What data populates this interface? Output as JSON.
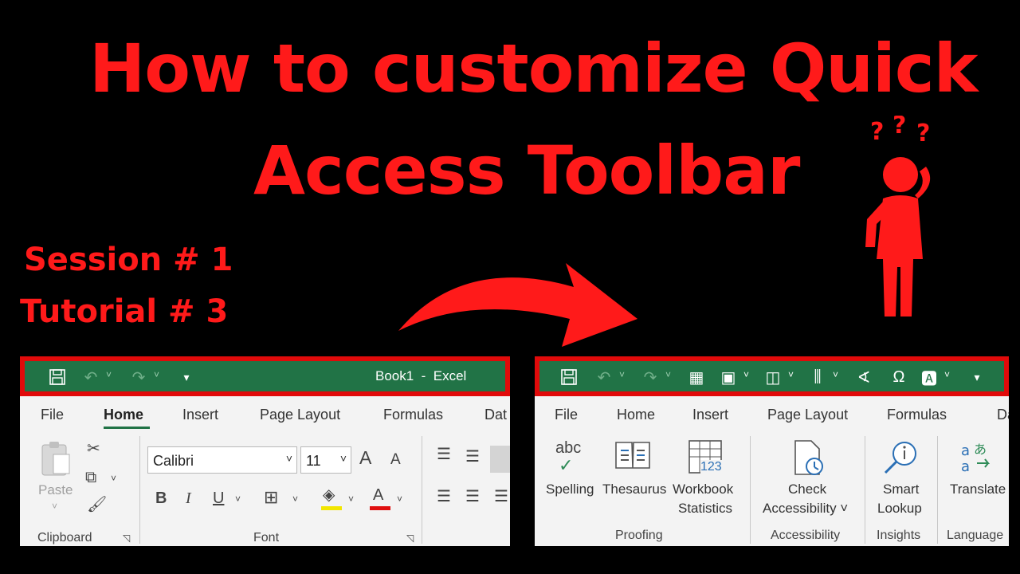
{
  "headline": {
    "line1": "How to customize Quick",
    "line2": "Access Toolbar"
  },
  "session": {
    "line1": "Session # 1",
    "line2": "Tutorial # 3"
  },
  "colors": {
    "accent_red": "#ff1a1a",
    "excel_green": "#217346",
    "highlight_border": "#e10a0a"
  },
  "left_panel": {
    "window_title": "Book1  -  Excel",
    "qat_icons": [
      "save-icon",
      "undo-icon",
      "redo-icon",
      "customize-qat-icon"
    ],
    "tabs": [
      "File",
      "Home",
      "Insert",
      "Page Layout",
      "Formulas",
      "Dat"
    ],
    "active_tab": "Home",
    "clipboard": {
      "paste_label": "Paste",
      "group_label": "Clipboard"
    },
    "font": {
      "font_name": "Calibri",
      "font_size": "11",
      "bold": "B",
      "italic": "I",
      "underline": "U",
      "grow": "A",
      "shrink": "A",
      "font_color": "A",
      "group_label": "Font"
    }
  },
  "right_panel": {
    "qat_icons": [
      "save-icon",
      "undo-icon",
      "redo-icon",
      "form-icon",
      "picture-icon",
      "shapes-icon",
      "chart-icon",
      "ink-icon",
      "symbol-icon",
      "text-box-icon",
      "customize-qat-icon"
    ],
    "tabs": [
      "File",
      "Home",
      "Insert",
      "Page Layout",
      "Formulas",
      "Dat"
    ],
    "commands": {
      "spelling": "Spelling",
      "spelling_icon_text": "abc",
      "thesaurus": "Thesaurus",
      "workbook_statistics_line1": "Workbook",
      "workbook_statistics_line2": "Statistics",
      "workbook_statistics_icon_text": "123",
      "check_accessibility_line1": "Check",
      "check_accessibility_line2": "Accessibility ˅",
      "smart_lookup_line1": "Smart",
      "smart_lookup_line2": "Lookup",
      "translate": "Translate"
    },
    "groups": [
      "Proofing",
      "Accessibility",
      "Insights",
      "Language"
    ]
  }
}
